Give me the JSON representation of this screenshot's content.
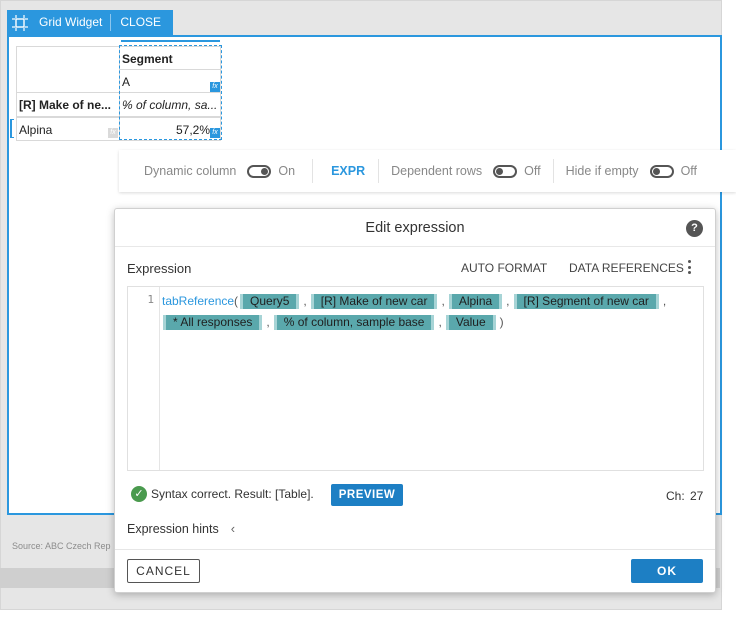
{
  "widget": {
    "title": "Grid Widget",
    "close_label": "CLOSE"
  },
  "grid": {
    "col_header": "Segment",
    "col_subheader": "A",
    "row_header": "[R] Make of ne...",
    "col_measure": "% of column, sa...",
    "row_label": "Alpina",
    "cell_value": "57,2%"
  },
  "toolbar": {
    "dynamic_column_label": "Dynamic column",
    "dynamic_column_state": "On",
    "expr_label": "EXPR",
    "dependent_rows_label": "Dependent rows",
    "dependent_rows_state": "Off",
    "hide_if_empty_label": "Hide if empty",
    "hide_if_empty_state": "Off"
  },
  "source_text": "Source: ABC Czech Rep",
  "dialog": {
    "title": "Edit expression",
    "expression_label": "Expression",
    "auto_format_label": "AUTO FORMAT",
    "data_references_label": "DATA REFERENCES",
    "line_number": "1",
    "function_name": "tabReference",
    "tokens": [
      "Query5",
      "[R] Make of new car",
      "Alpina",
      "[R] Segment of new car",
      "* All responses",
      "% of column, sample base",
      "Value"
    ],
    "status_text": "Syntax correct. Result: [Table].",
    "preview_label": "PREVIEW",
    "ch_label": "Ch:",
    "ch_value": "27",
    "hints_label": "Expression hints",
    "cancel_label": "CANCEL",
    "ok_label": "OK"
  },
  "colors": {
    "accent": "#2b97de",
    "token_bg": "#5aa8ac",
    "ok_green": "#4a9a4e",
    "button_blue": "#1d7fc4"
  }
}
